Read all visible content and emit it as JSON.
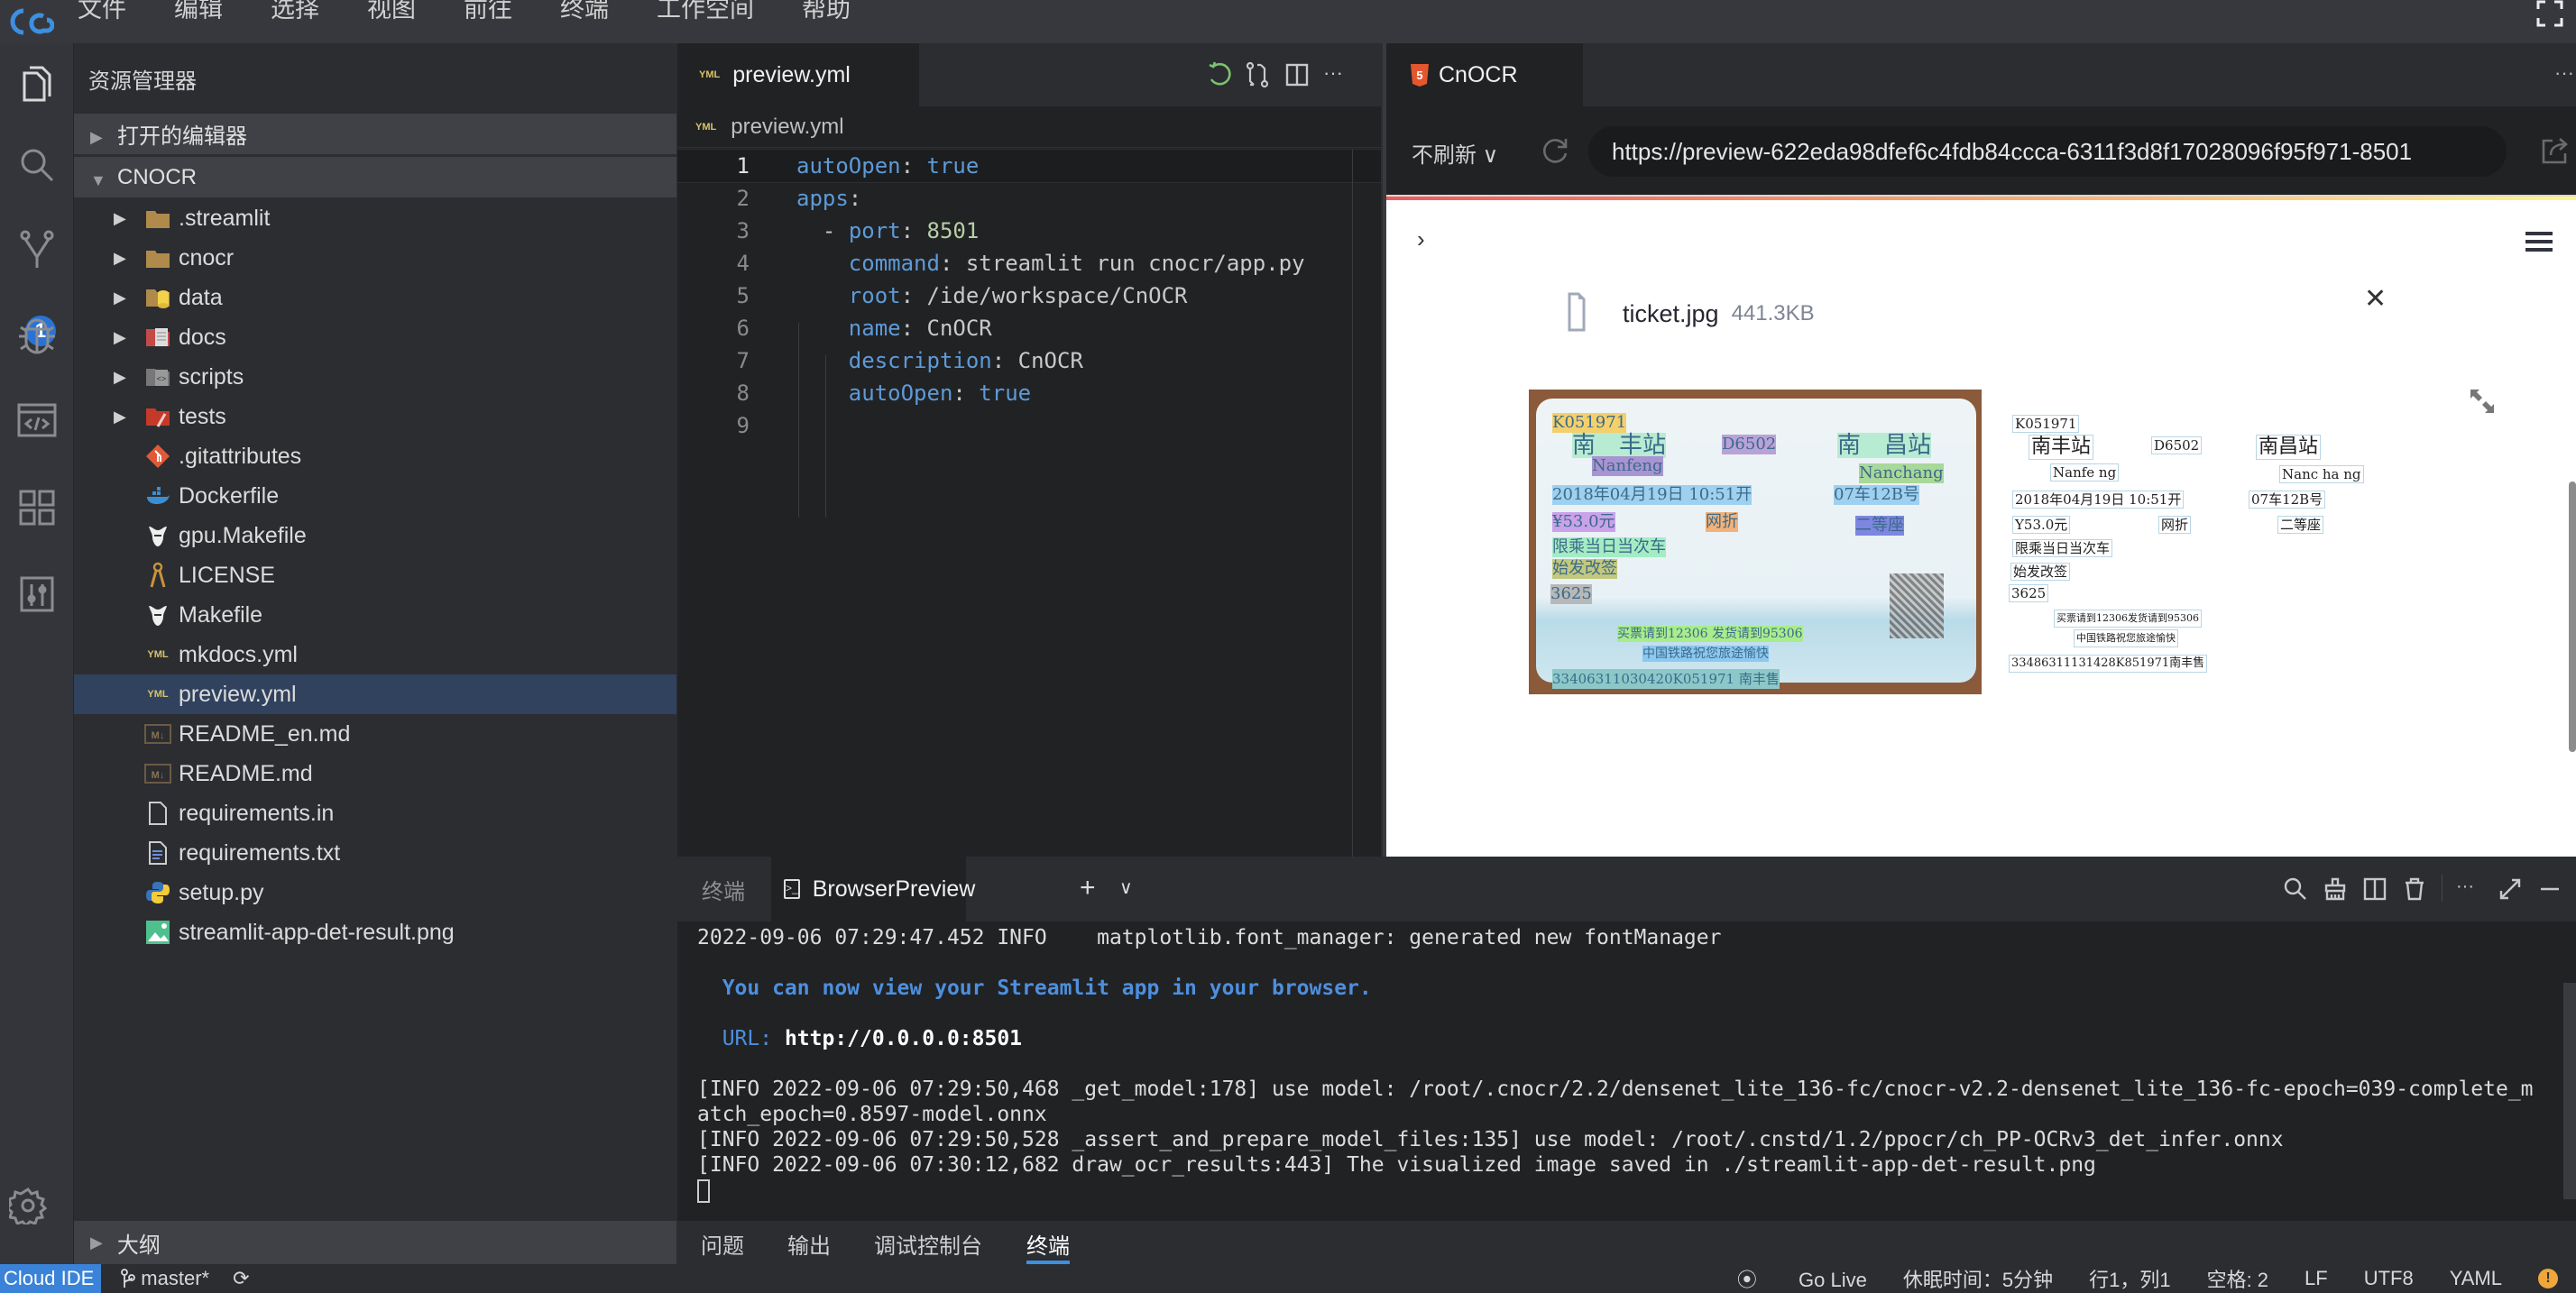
{
  "menubar": {
    "logo": "cc",
    "items": [
      "文件",
      "编辑",
      "选择",
      "视图",
      "前往",
      "终端",
      "工作空间",
      "帮助"
    ]
  },
  "activitybar": {
    "icons": [
      "explorer-icon",
      "search-icon",
      "source-control-icon",
      "debug-icon",
      "browser-preview-icon",
      "extensions-icon",
      "settings-panel-icon"
    ],
    "scm_badge": "1"
  },
  "sidebar": {
    "title": "资源管理器",
    "open_editors": "打开的编辑器",
    "project": "CNOCR",
    "tree": [
      {
        "name": ".streamlit",
        "type": "folder",
        "icon": "folder-icon"
      },
      {
        "name": "cnocr",
        "type": "folder",
        "icon": "folder-icon"
      },
      {
        "name": "data",
        "type": "folder",
        "icon": "folder-data-icon"
      },
      {
        "name": "docs",
        "type": "folder",
        "icon": "folder-docs-icon"
      },
      {
        "name": "scripts",
        "type": "folder",
        "icon": "folder-scripts-icon"
      },
      {
        "name": "tests",
        "type": "folder",
        "icon": "folder-tests-icon"
      },
      {
        "name": ".gitattributes",
        "type": "file",
        "icon": "git-icon"
      },
      {
        "name": "Dockerfile",
        "type": "file",
        "icon": "docker-icon"
      },
      {
        "name": "gpu.Makefile",
        "type": "file",
        "icon": "gnu-icon"
      },
      {
        "name": "LICENSE",
        "type": "file",
        "icon": "license-icon"
      },
      {
        "name": "Makefile",
        "type": "file",
        "icon": "gnu-icon"
      },
      {
        "name": "mkdocs.yml",
        "type": "file",
        "icon": "yaml-icon"
      },
      {
        "name": "preview.yml",
        "type": "file",
        "icon": "yaml-icon",
        "selected": true
      },
      {
        "name": "README_en.md",
        "type": "file",
        "icon": "markdown-icon"
      },
      {
        "name": "README.md",
        "type": "file",
        "icon": "markdown-icon"
      },
      {
        "name": "requirements.in",
        "type": "file",
        "icon": "file-icon"
      },
      {
        "name": "requirements.txt",
        "type": "file",
        "icon": "text-file-icon"
      },
      {
        "name": "setup.py",
        "type": "file",
        "icon": "python-icon"
      },
      {
        "name": "streamlit-app-det-result.png",
        "type": "file",
        "icon": "image-icon"
      }
    ],
    "outline": "大纲"
  },
  "editor": {
    "tab": "preview.yml",
    "yml_badge": "YML",
    "breadcrumb": "preview.yml",
    "lines": [
      {
        "num": "1",
        "indent": 0,
        "key": "autoOpen",
        "value": "true",
        "vtype": "bool"
      },
      {
        "num": "2",
        "indent": 0,
        "key": "apps",
        "value": "",
        "vtype": ""
      },
      {
        "num": "3",
        "indent": 1,
        "dash": true,
        "key": "port",
        "value": "8501",
        "vtype": "num"
      },
      {
        "num": "4",
        "indent": 2,
        "key": "command",
        "value": "streamlit run cnocr/app.py",
        "vtype": "str"
      },
      {
        "num": "5",
        "indent": 2,
        "key": "root",
        "value": "/ide/workspace/CnOCR",
        "vtype": "str"
      },
      {
        "num": "6",
        "indent": 2,
        "key": "name",
        "value": "CnOCR",
        "vtype": "str"
      },
      {
        "num": "7",
        "indent": 2,
        "key": "description",
        "value": "CnOCR",
        "vtype": "str"
      },
      {
        "num": "8",
        "indent": 2,
        "key": "autoOpen",
        "value": "true",
        "vtype": "bool"
      },
      {
        "num": "9",
        "indent": 0,
        "key": "",
        "value": "",
        "vtype": ""
      }
    ]
  },
  "preview": {
    "tab": "CnOCR",
    "refresh_mode": "不刷新 ∨",
    "url": "https://preview-622eda98dfef6c4fdb84ccca-6311f3d8f17028096f95f971-8501",
    "app": {
      "uploaded_file": "ticket.jpg",
      "uploaded_size": "441.3KB",
      "ticket_texts": [
        "K051971",
        "南　丰站",
        "D6502",
        "南　昌站",
        "Nanfeng",
        "Nanchang",
        "2018年04月19日 10:51开",
        "07车12B号",
        "¥53.0元",
        "网折",
        "二等座",
        "限乘当日当次车",
        "始发改签",
        "3625",
        "买票请到12306 发货请到95306",
        "中国铁路祝您旅途愉快",
        "33406311030420K051971 南丰售"
      ],
      "ocr_results": [
        "K051971",
        "南丰站",
        "D6502",
        "南昌站",
        "Nanfe ng",
        "Nanc ha ng",
        "2018年04月19日 10:51开",
        "07车12B号",
        "Y53.0元",
        "网折",
        "二等座",
        "限乘当日当次车",
        "始发改签",
        "3625",
        "买票请到12306发货请到95306",
        "中国铁路祝您旅途愉快",
        "33486311131428K851971南丰售"
      ]
    }
  },
  "panel": {
    "tab_terminal": "终端",
    "tab_browserpreview": "BrowserPreview",
    "terminal_lines": [
      {
        "text": "2022-09-06 07:29:47.452 INFO    matplotlib.font_manager: generated new fontManager",
        "style": ""
      },
      {
        "text": "",
        "style": ""
      },
      {
        "text": "  You can now view your Streamlit app in your browser.",
        "style": "blue"
      },
      {
        "text": "",
        "style": ""
      },
      {
        "label": "  URL: ",
        "text": "http://0.0.0.0:8501",
        "style": "url"
      },
      {
        "text": "",
        "style": ""
      },
      {
        "text": "[INFO 2022-09-06 07:29:50,468 _get_model:178] use model: /root/.cnocr/2.2/densenet_lite_136-fc/cnocr-v2.2-densenet_lite_136-fc-epoch=039-complete_m",
        "style": ""
      },
      {
        "text": "atch_epoch=0.8597-model.onnx",
        "style": ""
      },
      {
        "text": "[INFO 2022-09-06 07:29:50,528 _assert_and_prepare_model_files:135] use model: /root/.cnstd/1.2/ppocr/ch_PP-OCRv3_det_infer.onnx",
        "style": ""
      },
      {
        "text": "[INFO 2022-09-06 07:30:12,682 draw_ocr_results:443] The visualized image saved in ./streamlit-app-det-result.png",
        "style": ""
      }
    ],
    "bottom_tabs": [
      "问题",
      "输出",
      "调试控制台",
      "终端"
    ],
    "active_bottom_tab": "终端"
  },
  "statusbar": {
    "brand": "Cloud IDE",
    "branch": "master*",
    "go_live": "Go Live",
    "sleep": "休眠时间：5分钟",
    "position": "行1，列1",
    "spaces": "空格: 2",
    "eol": "LF",
    "encoding": "UTF8",
    "language": "YAML",
    "warning": "!"
  },
  "colors": {
    "accent": "#3a83d8",
    "badge": "#2a73d6",
    "yaml_key": "#5e9ad8",
    "number": "#b5cea8",
    "warning": "#f0a63a"
  }
}
